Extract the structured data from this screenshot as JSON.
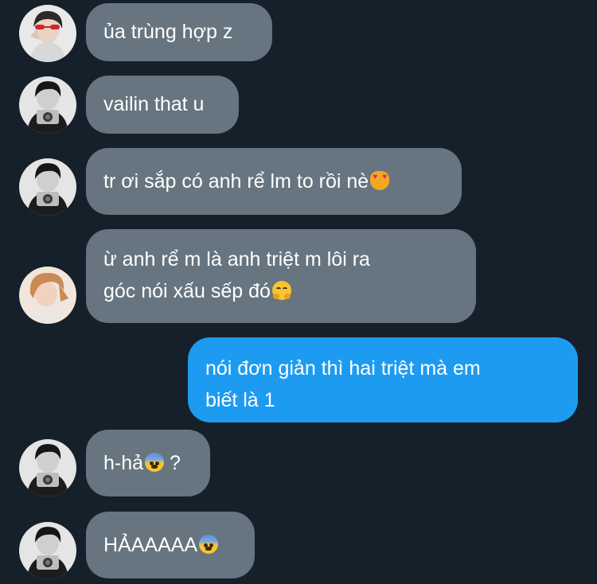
{
  "conversation": {
    "messages": [
      {
        "sender": "other",
        "avatar": "avatar-red-glasses",
        "text": "ủa trùng hợp z",
        "emoji": ""
      },
      {
        "sender": "other",
        "avatar": "avatar-camera",
        "text": "vailin that u",
        "emoji": ""
      },
      {
        "sender": "other",
        "avatar": "avatar-camera",
        "text": "tr ơi sắp có anh rể lm to rồi nè",
        "emoji": "heart-eyes-cat"
      },
      {
        "sender": "other",
        "avatar": "avatar-blond",
        "line1": "ừ anh rể m là anh triệt m lôi ra",
        "line2": "góc nói xấu sếp đó",
        "emoji": "hugging-face"
      },
      {
        "sender": "me",
        "line1": "nói đơn giản thì hai triệt mà em",
        "line2": "biết là 1"
      },
      {
        "sender": "other",
        "avatar": "avatar-camera",
        "text": "h-hả",
        "suffix": " ?",
        "emoji": "fearful-face"
      },
      {
        "sender": "other",
        "avatar": "avatar-camera",
        "text": "HẢAAAAA",
        "emoji": "fearful-face"
      }
    ]
  },
  "colors": {
    "background": "#15202b",
    "incoming_bubble": "#66757f",
    "outgoing_bubble": "#1d9bf0",
    "text": "#ffffff"
  }
}
